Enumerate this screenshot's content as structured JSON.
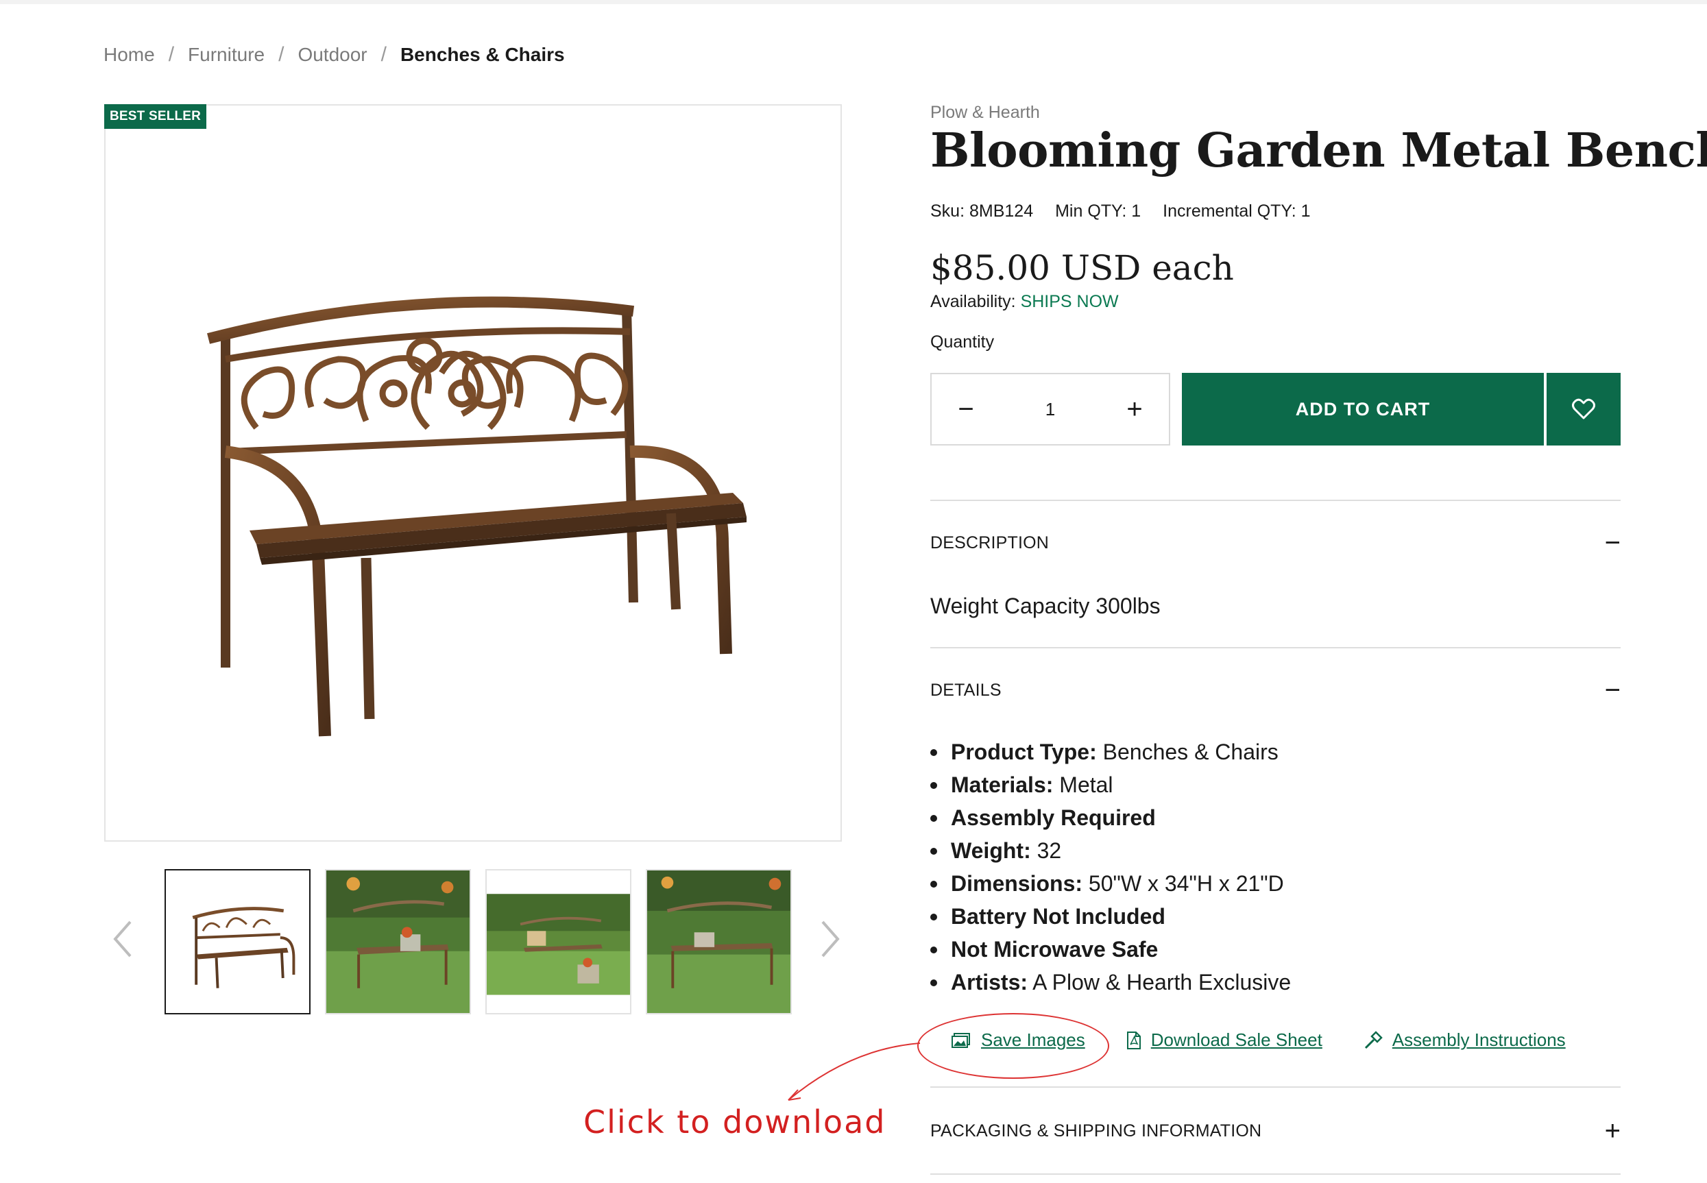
{
  "breadcrumb": {
    "items": [
      "Home",
      "Furniture",
      "Outdoor"
    ],
    "current": "Benches & Chairs",
    "separator": "/"
  },
  "product": {
    "badge": "BEST SELLER",
    "brand": "Plow & Hearth",
    "title": "Blooming Garden Metal Bench",
    "sku_label": "Sku:",
    "sku": "8MB124",
    "min_qty_label": "Min QTY:",
    "min_qty": "1",
    "incr_qty_label": "Incremental QTY:",
    "incr_qty": "1",
    "price": "$85.00 USD each",
    "availability_label": "Availability:",
    "availability": "SHIPS NOW"
  },
  "quantity": {
    "label": "Quantity",
    "value": "1",
    "minus": "−",
    "plus": "+"
  },
  "actions": {
    "add_to_cart": "ADD TO CART",
    "wishlist_icon": "heart-icon"
  },
  "accordion": {
    "description": {
      "title": "DESCRIPTION",
      "toggle": "−",
      "text": "Weight Capacity 300lbs"
    },
    "details": {
      "title": "DETAILS",
      "toggle": "−",
      "items": [
        {
          "label": "Product Type:",
          "value": "Benches & Chairs"
        },
        {
          "label": "Materials:",
          "value": "Metal"
        },
        {
          "label": "Assembly Required",
          "value": ""
        },
        {
          "label": "Weight:",
          "value": "32"
        },
        {
          "label": "Dimensions:",
          "value": "50\"W x 34\"H x 21\"D"
        },
        {
          "label": "Battery Not Included",
          "value": ""
        },
        {
          "label": "Not Microwave Safe",
          "value": ""
        },
        {
          "label": "Artists:",
          "value": "A Plow & Hearth Exclusive"
        }
      ]
    },
    "packaging": {
      "title": "PACKAGING & SHIPPING INFORMATION",
      "toggle": "+"
    }
  },
  "downloads": {
    "save_images": "Save Images",
    "sale_sheet": "Download Sale Sheet",
    "assembly": "Assembly Instructions"
  },
  "annotation": {
    "text": "Click to download",
    "color": "#d32020"
  },
  "colors": {
    "brand_green": "#0c6a4a",
    "status_green": "#0c7a52"
  },
  "thumbnails": [
    {
      "name": "bench-white-background"
    },
    {
      "name": "bench-in-garden-front"
    },
    {
      "name": "bench-in-garden-wide"
    },
    {
      "name": "bench-in-garden-angle"
    }
  ]
}
